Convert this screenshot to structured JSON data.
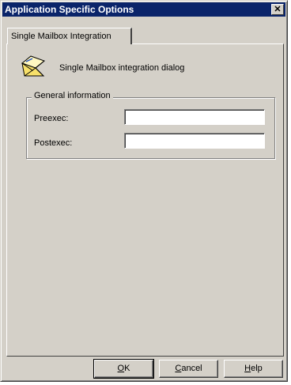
{
  "window": {
    "title": "Application Specific Options",
    "close_symbol": "✕"
  },
  "tab": {
    "label": "Single Mailbox Integration"
  },
  "dialog": {
    "icon": "mail-envelope-icon",
    "title": "Single Mailbox integration dialog"
  },
  "group": {
    "label": "General information",
    "fields": [
      {
        "label": "Preexec:",
        "value": ""
      },
      {
        "label": "Postexec:",
        "value": ""
      }
    ]
  },
  "buttons": {
    "ok": {
      "mnemonic": "O",
      "rest": "K"
    },
    "cancel": {
      "mnemonic": "C",
      "rest": "ancel"
    },
    "help": {
      "mnemonic": "H",
      "rest": "elp"
    }
  },
  "colors": {
    "titlebar": "#0a246a",
    "face": "#d4d0c8"
  }
}
